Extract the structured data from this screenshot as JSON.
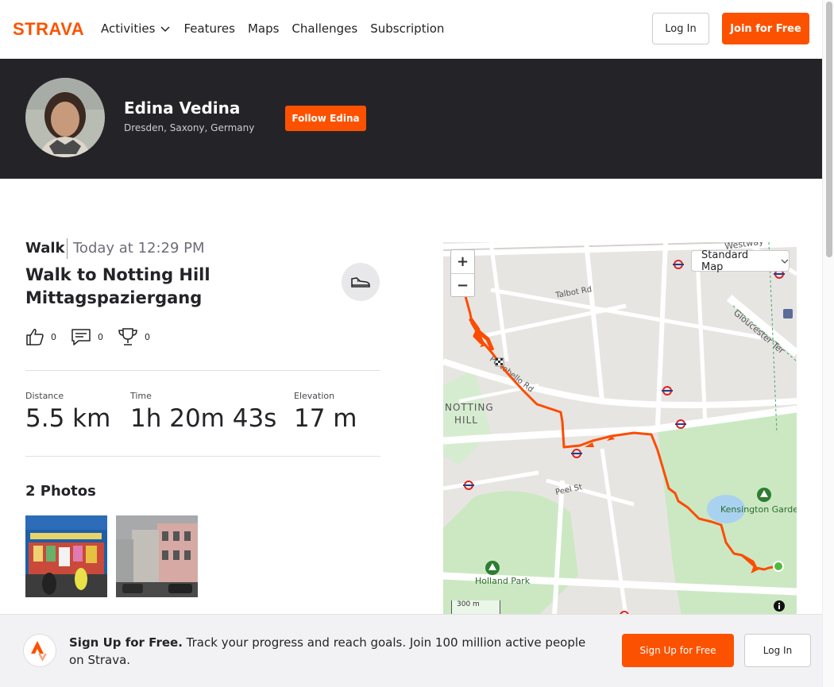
{
  "brand": {
    "name": "STRAVA",
    "accent": "#fc5200",
    "dark": "#242428"
  },
  "nav": {
    "items": [
      {
        "label": "Activities",
        "has_dropdown": true
      },
      {
        "label": "Features"
      },
      {
        "label": "Maps"
      },
      {
        "label": "Challenges"
      },
      {
        "label": "Subscription"
      }
    ],
    "login_label": "Log In",
    "join_label": "Join for Free"
  },
  "athlete": {
    "name": "Edina Vedina",
    "location": "Dresden, Saxony, Germany",
    "follow_label": "Follow Edina"
  },
  "activity": {
    "type": "Walk",
    "date": "Today at 12:29 PM",
    "title": "Walk to Notting Hill Mittagspaziergang",
    "kudos_count": "0",
    "comments_count": "0",
    "achievements_count": "0",
    "stats": [
      {
        "label": "Distance",
        "value": "5.5 km"
      },
      {
        "label": "Time",
        "value": "1h 20m 43s"
      },
      {
        "label": "Elevation",
        "value": "17 m"
      }
    ],
    "photos_title": "2 Photos"
  },
  "map": {
    "style_select": "Standard Map",
    "zoom_in": "+",
    "zoom_out": "−",
    "scale": "300 m",
    "labels": {
      "westway": "Westway",
      "talbot": "Talbot Rd",
      "gloucester": "Gloucester Ter",
      "portobello": "Portobello Rd",
      "notting": "NOTTING",
      "hill": "HILL",
      "peel": "Peel St",
      "kensington": "Kensington Garde",
      "holland": "Holland Park"
    },
    "route_color": "#fc4c02"
  },
  "signup_bar": {
    "bold": "Sign Up for Free.",
    "text": " Track your progress and reach goals. Join 100 million active people on Strava.",
    "signup_label": "Sign Up for Free",
    "login_label": "Log In"
  }
}
